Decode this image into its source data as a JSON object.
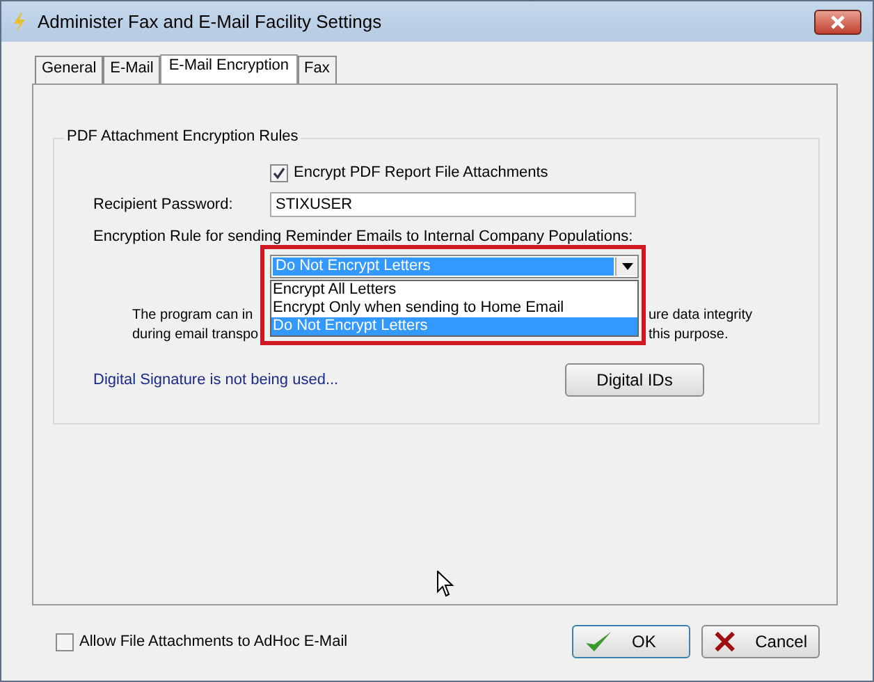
{
  "window": {
    "title": "Administer Fax and E-Mail Facility Settings"
  },
  "tabs": [
    {
      "label": "General",
      "selected": false
    },
    {
      "label": "E-Mail",
      "selected": false
    },
    {
      "label": "E-Mail Encryption",
      "selected": true
    },
    {
      "label": "Fax",
      "selected": false
    }
  ],
  "group": {
    "title": "PDF Attachment Encryption Rules",
    "encrypt_checkbox": {
      "label": "Encrypt PDF Report File Attachments",
      "checked": true
    },
    "password": {
      "label": "Recipient Password:",
      "value": "STIXUSER"
    },
    "rule_label": "Encryption Rule for sending Reminder Emails to Internal Company Populations:",
    "rule_combo": {
      "value": "Do Not Encrypt Letters",
      "options": [
        {
          "label": "Encrypt All Letters",
          "selected": false
        },
        {
          "label": "Encrypt Only when sending to Home Email",
          "selected": false
        },
        {
          "label": "Do Not Encrypt Letters",
          "selected": true
        }
      ]
    },
    "paragraph_lines": [
      {
        "left": "The program can in",
        "right": "ure data integrity"
      },
      {
        "left": "during email transpo",
        "right": "this purpose."
      }
    ],
    "signature_status": "Digital Signature is not being used...",
    "digital_ids_button": "Digital IDs"
  },
  "allow_attachments": {
    "label": "Allow File Attachments to AdHoc E-Mail",
    "checked": false
  },
  "buttons": [
    {
      "kind": "ok",
      "label": "OK"
    },
    {
      "kind": "cancel",
      "label": "Cancel"
    }
  ]
}
